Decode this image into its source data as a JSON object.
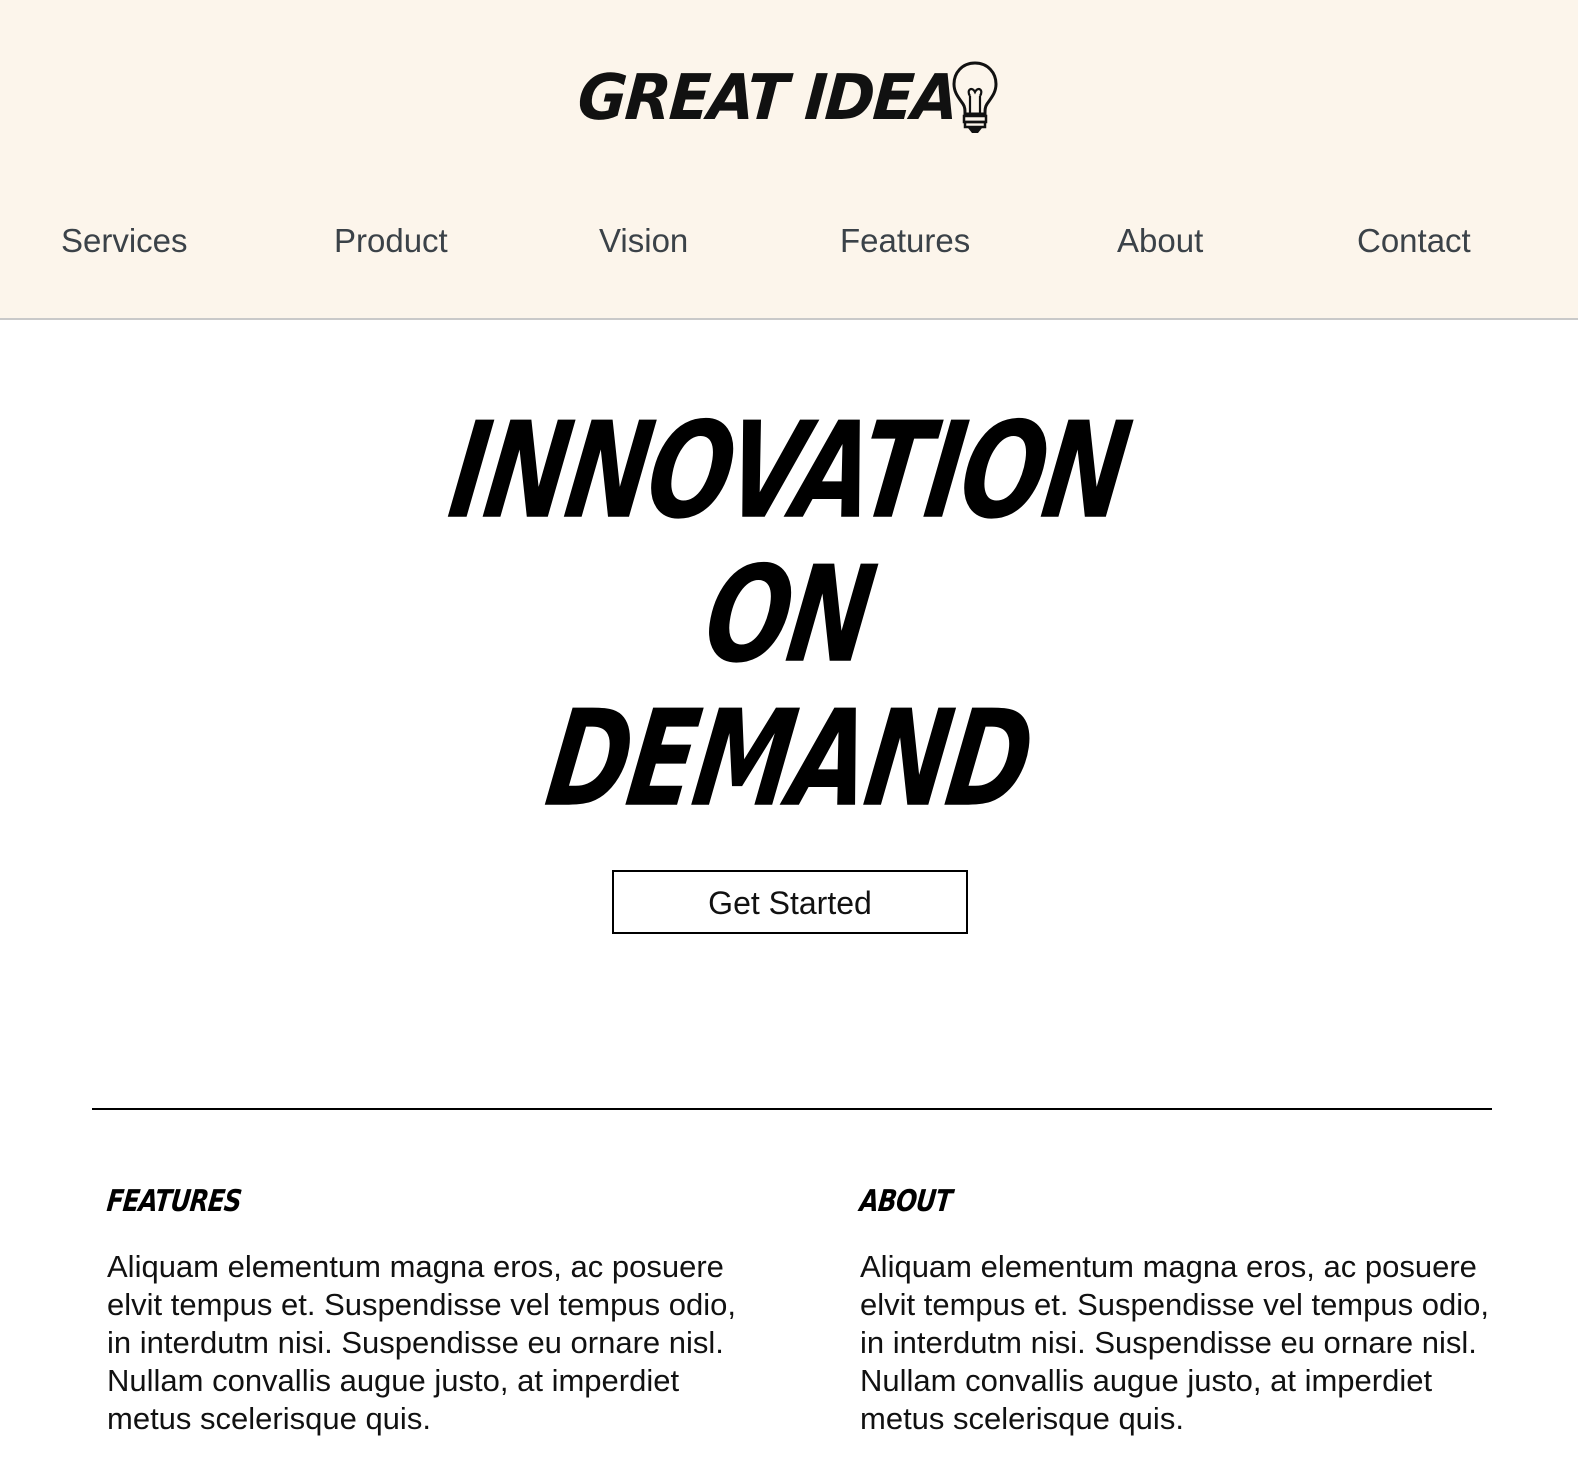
{
  "header": {
    "logo_text": "GREAT IDEA",
    "logo_icon": "lightbulb-icon",
    "background": "#fcf5eb"
  },
  "nav": {
    "items": [
      {
        "label": "Services"
      },
      {
        "label": "Product"
      },
      {
        "label": "Vision"
      },
      {
        "label": "Features"
      },
      {
        "label": "About"
      },
      {
        "label": "Contact"
      }
    ]
  },
  "hero": {
    "lines": [
      "INNOVATION",
      "ON",
      "DEMAND"
    ],
    "cta_label": "Get Started"
  },
  "sections": [
    {
      "heading": "FEATURES",
      "body": "Aliquam elementum magna eros, ac posuere elvit tempus et. Suspendisse vel tempus odio, in interdutm nisi. Suspendisse eu ornare nisl. Nullam convallis augue justo, at imperdiet metus scelerisque quis."
    },
    {
      "heading": "ABOUT",
      "body": "Aliquam elementum magna eros, ac posuere elvit tempus et. Suspendisse vel tempus odio, in interdutm nisi. Suspendisse eu ornare nisl. Nullam convallis augue justo, at imperdiet metus scelerisque quis."
    }
  ]
}
